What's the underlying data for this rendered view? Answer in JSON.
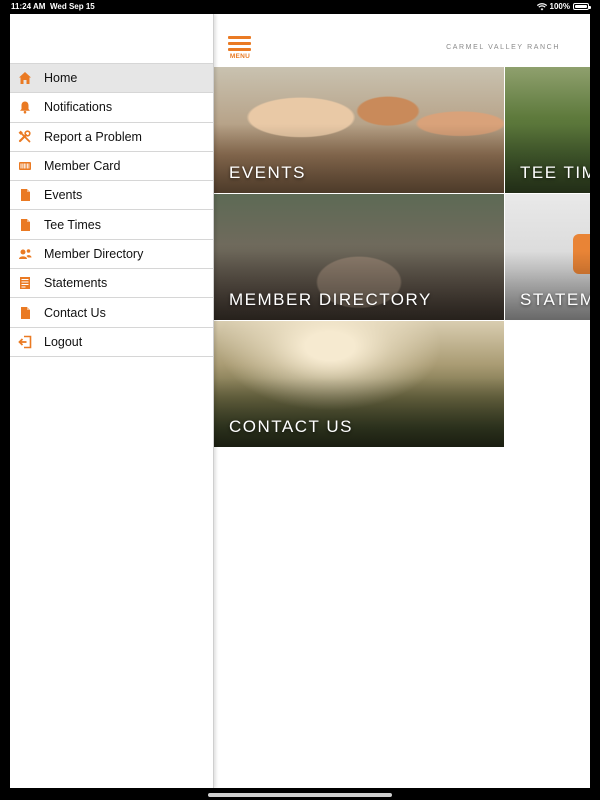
{
  "status_bar": {
    "time": "11:24 AM",
    "date": "Wed Sep 15",
    "battery": "100%"
  },
  "sidebar": {
    "items": [
      {
        "label": "Home",
        "icon": "home-icon",
        "active": true
      },
      {
        "label": "Notifications",
        "icon": "bell-icon",
        "active": false
      },
      {
        "label": "Report a Problem",
        "icon": "tools-icon",
        "active": false
      },
      {
        "label": "Member Card",
        "icon": "barcode-card-icon",
        "active": false
      },
      {
        "label": "Events",
        "icon": "document-icon",
        "active": false
      },
      {
        "label": "Tee Times",
        "icon": "document-icon",
        "active": false
      },
      {
        "label": "Member Directory",
        "icon": "people-icon",
        "active": false
      },
      {
        "label": "Statements",
        "icon": "statement-icon",
        "active": false
      },
      {
        "label": "Contact Us",
        "icon": "document-icon",
        "active": false
      },
      {
        "label": "Logout",
        "icon": "logout-icon",
        "active": false
      }
    ]
  },
  "header": {
    "menu_label": "MENU",
    "brand": "CARMEL VALLEY RANCH"
  },
  "tiles": {
    "events": "EVENTS",
    "tee_times": "TEE TIMES",
    "member_directory": "MEMBER DIRECTORY",
    "statements": "STATEMENTS",
    "contact_us": "CONTACT US"
  },
  "colors": {
    "accent": "#ea7a23",
    "active_row": "#e6e6e6"
  }
}
